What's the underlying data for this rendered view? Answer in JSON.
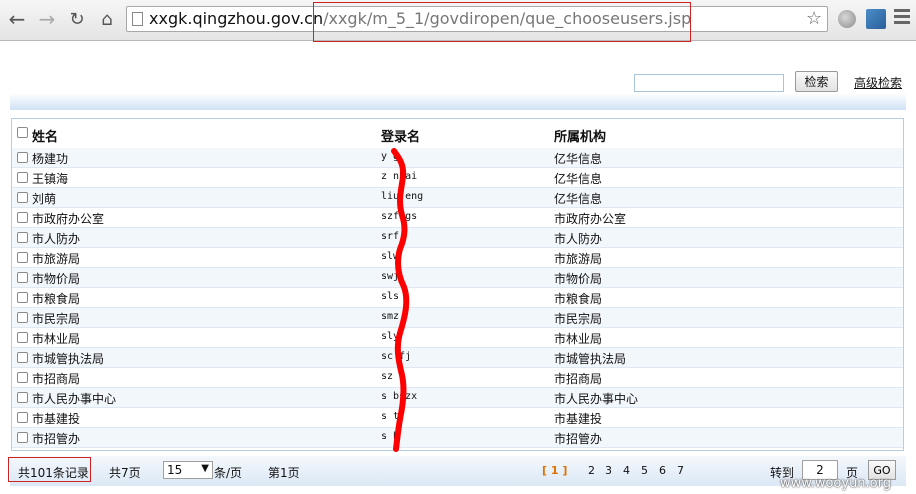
{
  "browser": {
    "url_host": "xxgk.qingzhou.gov.cn",
    "url_path": "/xxgk/m_5_1/govdiropen/que_chooseusers.jsp"
  },
  "search": {
    "button_label": "检索",
    "advanced_link": "高级检索"
  },
  "table": {
    "headers": {
      "name": "姓名",
      "login": "登录名",
      "org": "所属机构"
    },
    "rows": [
      {
        "name": "杨建功",
        "login": "y  g",
        "org": "亿华信息"
      },
      {
        "name": "王镇海",
        "login": "z  nhai",
        "org": "亿华信息"
      },
      {
        "name": "刘萌",
        "login": "liu eng",
        "org": "亿华信息"
      },
      {
        "name": "市政府办公室",
        "login": "szf gs",
        "org": "市政府办公室"
      },
      {
        "name": "市人防办",
        "login": "srf",
        "org": "市人防办"
      },
      {
        "name": "市旅游局",
        "login": "slw",
        "org": "市旅游局"
      },
      {
        "name": "市物价局",
        "login": "swj",
        "org": "市物价局"
      },
      {
        "name": "市粮食局",
        "login": "sls",
        "org": "市粮食局"
      },
      {
        "name": "市民宗局",
        "login": "smz",
        "org": "市民宗局"
      },
      {
        "name": "市林业局",
        "login": "sly",
        "org": "市林业局"
      },
      {
        "name": "市城管执法局",
        "login": "sc  fj",
        "org": "市城管执法局"
      },
      {
        "name": "市招商局",
        "login": "sz  j",
        "org": "市招商局"
      },
      {
        "name": "市人民办事中心",
        "login": "s  bszx",
        "org": "市人民办事中心"
      },
      {
        "name": "市基建投",
        "login": "s  t",
        "org": "市基建投"
      },
      {
        "name": "市招管办",
        "login": "s  b",
        "org": "市招管办"
      }
    ]
  },
  "pagination": {
    "total_records": "共101条记录",
    "total_pages": "共7页",
    "page_size": "15",
    "per_page_suffix": "条/页",
    "current_page_text": "第1页",
    "pages": [
      "[ 1 ]",
      "2",
      "3",
      "4",
      "5",
      "6",
      "7"
    ],
    "current_index": 0,
    "jump_label": "转到",
    "jump_value": "2",
    "jump_suffix": "页",
    "go_label": "GO"
  },
  "watermark": "www.wooyun.org",
  "colors": {
    "highlight_box": "#cc2222",
    "scribble": "#ff0000",
    "current_page": "#e07000"
  }
}
